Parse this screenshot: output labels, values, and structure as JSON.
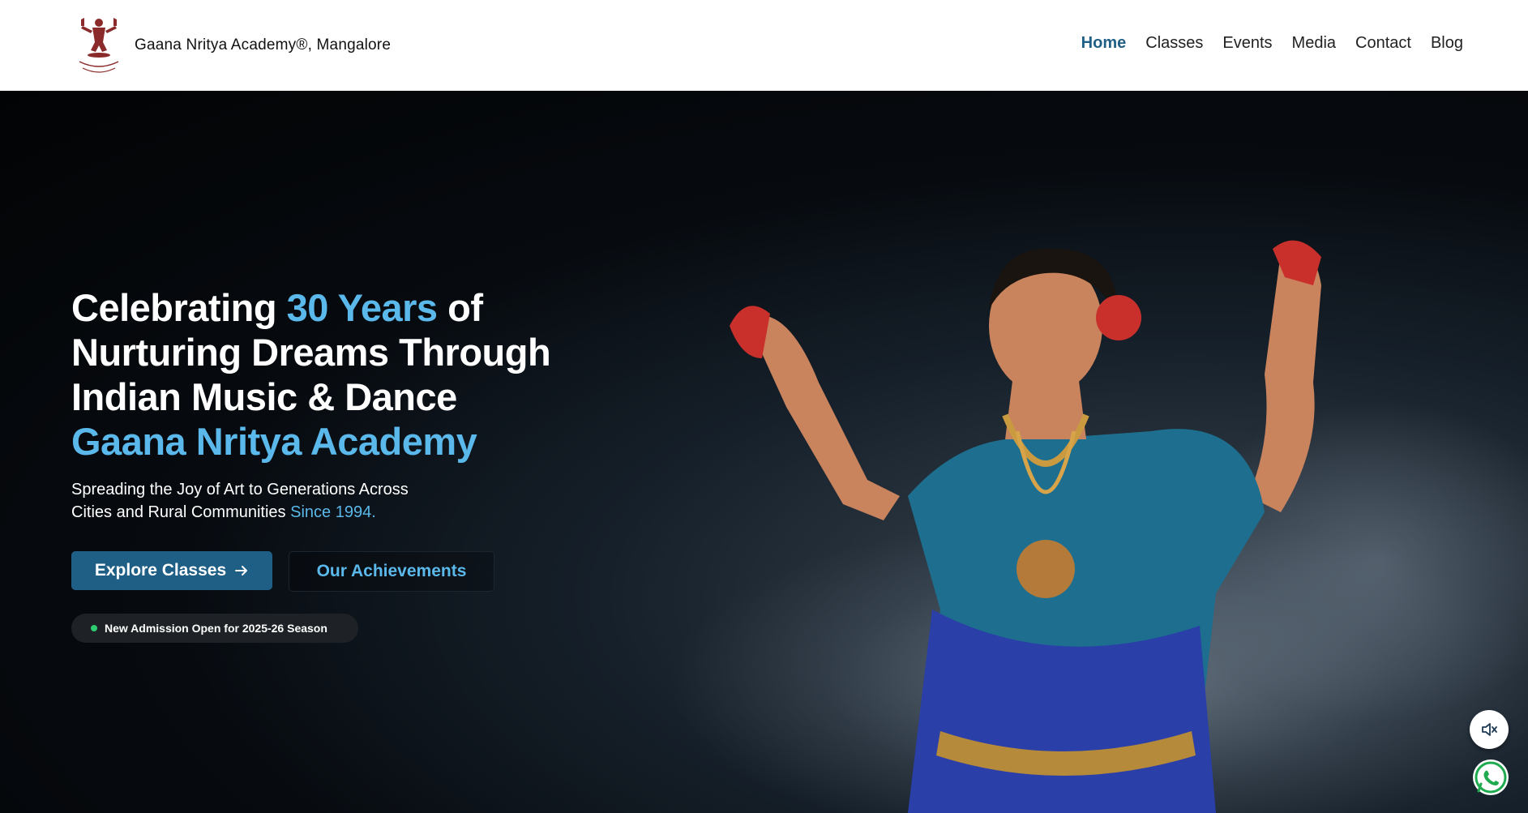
{
  "header": {
    "brand_name": "Gaana Nritya Academy®, Mangalore",
    "nav": [
      {
        "label": "Home",
        "active": true
      },
      {
        "label": "Classes"
      },
      {
        "label": "Events"
      },
      {
        "label": "Media"
      },
      {
        "label": "Contact"
      },
      {
        "label": "Blog"
      }
    ]
  },
  "hero": {
    "headline": {
      "part1": "Celebrating ",
      "accent1": "30 Years",
      "part2": " of Nurturing Dreams Through Indian Music & Dance",
      "accent2": "Gaana Nritya Academy"
    },
    "subtext": "Spreading the Joy of Art to Generations Across Cities and Rural Communities ",
    "subtext_accent": "Since 1994.",
    "primary_button": "Explore Classes",
    "secondary_button": "Our Achievements",
    "badge": "New Admission Open for 2025-26 Season"
  },
  "floating": {
    "mute_icon": "speaker-mute-icon",
    "whatsapp_icon": "whatsapp-icon"
  },
  "colors": {
    "accent": "#5ab8ea",
    "primary": "#1f5f86",
    "badge_dot": "#2ecc71"
  }
}
